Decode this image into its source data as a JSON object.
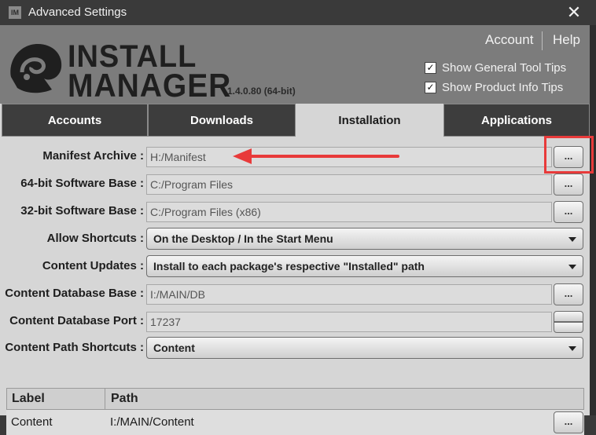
{
  "window": {
    "title": "Advanced Settings",
    "icon_label": "IM",
    "close": "✕"
  },
  "header": {
    "logo_line1": "INSTALL",
    "logo_line2": "MANAGER",
    "version": "1.4.0.80 (64-bit)",
    "links": {
      "account": "Account",
      "help": "Help"
    },
    "checkboxes": [
      {
        "label": "Show General Tool Tips",
        "checked": true
      },
      {
        "label": "Show Product Info Tips",
        "checked": true
      }
    ]
  },
  "tabs": [
    {
      "label": "Accounts",
      "active": false
    },
    {
      "label": "Downloads",
      "active": false
    },
    {
      "label": "Installation",
      "active": true
    },
    {
      "label": "Applications",
      "active": false
    }
  ],
  "form": {
    "manifest_archive": {
      "label": "Manifest Archive :",
      "value": "H:/Manifest",
      "browse": "..."
    },
    "sw_base_64": {
      "label": "64-bit Software Base :",
      "value": "C:/Program Files",
      "browse": "..."
    },
    "sw_base_32": {
      "label": "32-bit Software Base :",
      "value": "C:/Program Files (x86)",
      "browse": "..."
    },
    "allow_shortcuts": {
      "label": "Allow Shortcuts :",
      "value": "On the Desktop / In the Start Menu"
    },
    "content_updates": {
      "label": "Content Updates :",
      "value": "Install to each package's respective \"Installed\" path"
    },
    "content_db_base": {
      "label": "Content Database Base :",
      "value": "I:/MAIN/DB",
      "browse": "..."
    },
    "content_db_port": {
      "label": "Content Database Port :",
      "value": "17237"
    },
    "content_path_shortcuts": {
      "label": "Content Path Shortcuts :",
      "value": "Content"
    }
  },
  "table": {
    "columns": [
      "Label",
      "Path"
    ],
    "rows": [
      {
        "label": "Content",
        "path": "I:/MAIN/Content",
        "browse": "..."
      }
    ]
  },
  "annotation": {
    "highlight_color": "#e83a3a"
  }
}
